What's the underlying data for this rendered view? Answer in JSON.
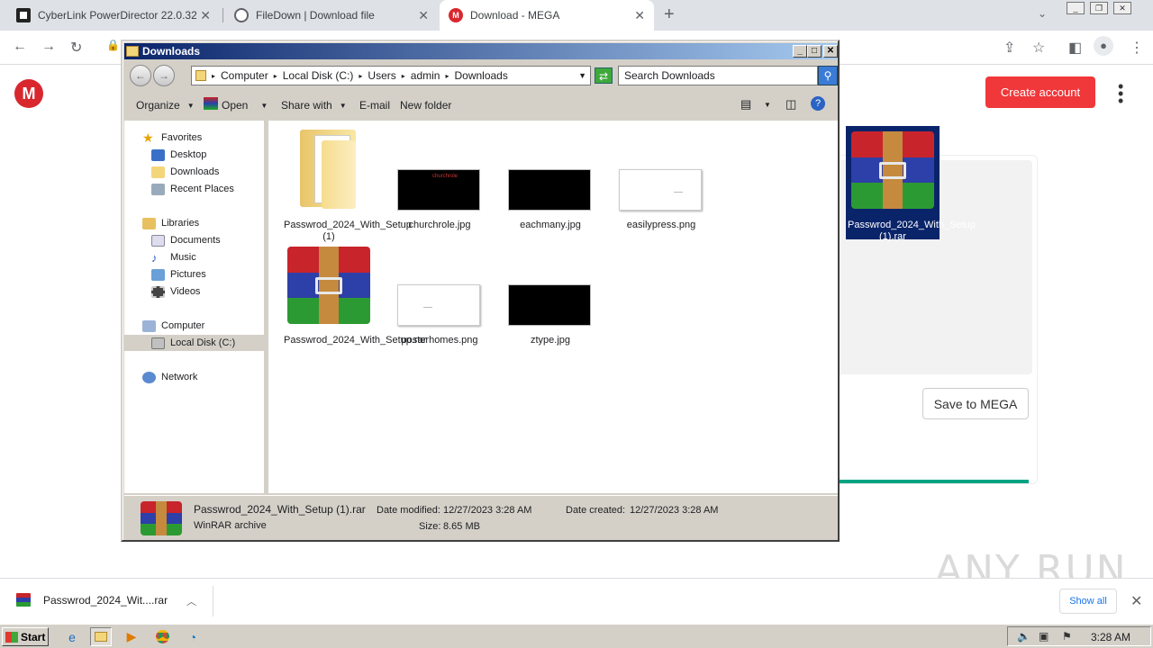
{
  "browser": {
    "tabs": [
      {
        "title": "CyberLink PowerDirector 22.0.3215",
        "favicon": "cyberlink-icon",
        "active": false
      },
      {
        "title": "FileDown | Download file",
        "favicon": "globe-icon",
        "active": false
      },
      {
        "title": "Download - MEGA",
        "favicon": "mega-icon",
        "active": true
      }
    ],
    "new_tab": "+",
    "window_controls": [
      "_",
      "❐",
      "✕"
    ]
  },
  "mega": {
    "logo": "M",
    "create_account": "Create account",
    "save_button": "Save to MEGA",
    "progress": 1.0,
    "accent_color": "#f0373a"
  },
  "explorer": {
    "title": "Downloads",
    "breadcrumbs": [
      "Computer",
      "Local Disk (C:)",
      "Users",
      "admin",
      "Downloads"
    ],
    "search_placeholder": "Search Downloads",
    "toolbar": {
      "organize": "Organize",
      "open": "Open",
      "share_with": "Share with",
      "email": "E-mail",
      "new_folder": "New folder"
    },
    "nav": {
      "favorites": "Favorites",
      "desktop": "Desktop",
      "downloads": "Downloads",
      "recent_places": "Recent Places",
      "libraries": "Libraries",
      "documents": "Documents",
      "music": "Music",
      "pictures": "Pictures",
      "videos": "Videos",
      "computer": "Computer",
      "local_disk": "Local Disk (C:)",
      "network": "Network"
    },
    "files": [
      {
        "name": "Passwrod_2024_With_Setup (1)",
        "type": "folder"
      },
      {
        "name": "churchrole.jpg",
        "type": "image-black",
        "thumb_text": "churchrole"
      },
      {
        "name": "eachmany.jpg",
        "type": "image-black"
      },
      {
        "name": "easilypress.png",
        "type": "image-white"
      },
      {
        "name": "Passwrod_2024_With_Setup (1).rar",
        "type": "rar",
        "selected": true
      },
      {
        "name": "Passwrod_2024_With_Setup.rar",
        "type": "rar"
      },
      {
        "name": "posterhomes.png",
        "type": "image-white"
      },
      {
        "name": "ztype.jpg",
        "type": "image-black"
      }
    ],
    "details": {
      "name": "Passwrod_2024_With_Setup (1).rar",
      "type": "WinRAR archive",
      "date_modified_label": "Date modified:",
      "date_modified": "12/27/2023 3:28 AM",
      "size_label": "Size:",
      "size": "8.65 MB",
      "date_created_label": "Date created:",
      "date_created": "12/27/2023 3:28 AM"
    }
  },
  "download_bar": {
    "file": "Passwrod_2024_Wit....rar",
    "show_all": "Show all"
  },
  "watermark": "ANY RUN",
  "taskbar": {
    "start": "Start",
    "clock": "3:28 AM"
  }
}
